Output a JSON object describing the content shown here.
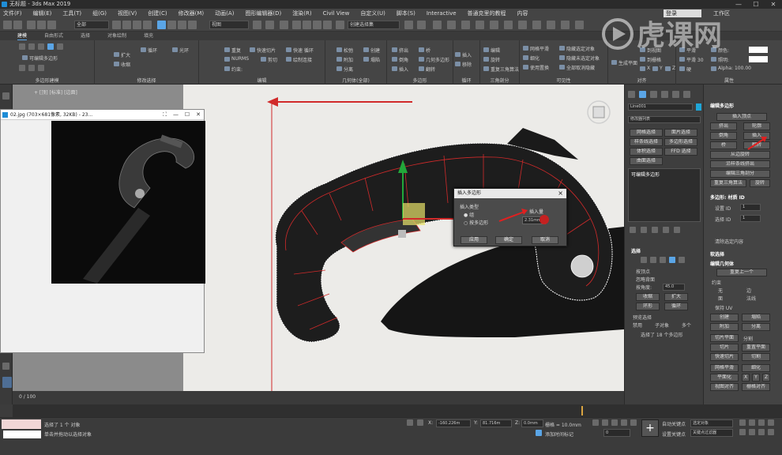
{
  "window": {
    "title": "无标题 - 3ds Max 2019",
    "minimize": "—",
    "maximize": "☐",
    "close": "✕"
  },
  "menu": {
    "items": [
      "文件(F)",
      "编辑(E)",
      "工具(T)",
      "组(G)",
      "视图(V)",
      "创建(C)",
      "修改器(M)",
      "动画(A)",
      "图形编辑器(D)",
      "渲染(R)",
      "Civil View",
      "自定义(U)",
      "脚本(S)",
      "Interactive",
      "普通克里的教程",
      "内容"
    ],
    "signin": "登录",
    "workspace": "工作区"
  },
  "toolbar": {
    "filter": "全部",
    "view": "视图",
    "selection_set": "创建选择集"
  },
  "ribbon": {
    "tabs": [
      "建模",
      "自由形式",
      "选择",
      "对象绘制",
      "填充"
    ],
    "active_tab": "建模",
    "mode_label": "可编辑多边形",
    "groups": [
      {
        "label": "多边形建模",
        "items": []
      },
      {
        "label": "修改选择",
        "items": [
          "扩大",
          "收缩",
          "循环",
          "光环"
        ]
      },
      {
        "label": "编辑",
        "items": [
          "重复",
          "快速切片",
          "快速 循环",
          "NURMS",
          "剪切",
          "绘制连接",
          "约束:"
        ]
      },
      {
        "label": "几何体(全部)",
        "items": [
          "松弛",
          "创建",
          "附加",
          "塌陷",
          "分离"
        ]
      },
      {
        "label": "多边形",
        "items": [
          "挤出",
          "倒角",
          "插入",
          "翻转",
          "桥",
          "几何多边形"
        ]
      },
      {
        "label": "循环",
        "items": [
          "插入",
          "移除"
        ]
      },
      {
        "label": "三角剖分",
        "items": [
          "编辑",
          "旋转",
          "重复三角算法"
        ]
      },
      {
        "label": "可见性",
        "items": [
          "隐藏选定对象",
          "隐藏未选定对象",
          "全部取消隐藏",
          "网格平滑",
          "细化",
          "使用置换"
        ]
      },
      {
        "label": "对齐",
        "items": [
          "生成平面",
          "到视图",
          "到栅格",
          "X",
          "Y",
          "Z"
        ]
      },
      {
        "label": "属性",
        "items": [
          "平滑",
          "平滑 30",
          "硬",
          "颜色:",
          "照明:",
          "Alpha: 100.00"
        ]
      }
    ]
  },
  "viewport": {
    "label": "+ [顶] [标准] [边面]"
  },
  "image_window": {
    "title": "02.jpg (703×681像素, 32KB) - 23..."
  },
  "dialog": {
    "title": "插入多边形",
    "insert_type_label": "插入类型",
    "option_group": "组",
    "option_by_poly": "按多边形",
    "amount_label": "插入量",
    "amount_value": "2.31mm",
    "apply": "应用",
    "ok": "确定",
    "cancel": "取消"
  },
  "command_panel": {
    "object_name": "Line001",
    "modifier_list": "修改器列表",
    "modifier_buttons": [
      "网格选择",
      "面片选择",
      "样条线选择",
      "多边形选择",
      "体积选择",
      "FFD 选择",
      "曲面选择"
    ],
    "stack_item": "可编辑多边形",
    "selection_header": "选择",
    "sel_options": [
      "按顶点",
      "忽略背面",
      "按角度:",
      "45.0",
      "收缩",
      "扩大",
      "环形",
      "循环"
    ],
    "preview_label": "预览选择",
    "preview_options": [
      "禁用",
      "子对象",
      "多个"
    ],
    "selected_text": "选择了 18 个多边形"
  },
  "edit_panel": {
    "edit_poly_header": "编辑多边形",
    "insert_vertex": "插入顶点",
    "buttons": [
      "挤出",
      "轮廓",
      "倒角",
      "插入",
      "桥",
      "翻转",
      "从边旋转",
      "沿样条线挤出",
      "编辑三角剖分",
      "重复三角算法",
      "旋转"
    ],
    "material_header": "多边形: 材质 ID",
    "set_id_label": "设置 ID",
    "set_id_value": "1",
    "select_id_label": "选择 ID",
    "select_id_value": "1",
    "clear_selection": "清除选定内容",
    "soft_select": "软选择",
    "edit_geometry": "编辑几何体",
    "repeat_last": "重复上一个",
    "constraint_label": "约束",
    "constraint_opts": [
      "无",
      "边",
      "面",
      "法线"
    ],
    "keep_uv": "保持 UV",
    "geo_buttons": [
      "创建",
      "塌陷",
      "附加",
      "分离",
      "切片平面",
      "分割",
      "切片",
      "重置平面",
      "快速切片",
      "切割"
    ],
    "mesh_smooth": "网格平滑",
    "tessellate": "细化",
    "planarize": "平面化",
    "xyz": [
      "X",
      "Y",
      "Z"
    ],
    "view_align": "视图对齐",
    "grid_align": "栅格对齐"
  },
  "status": {
    "selected": "选择了 1 个 对象",
    "hint": "单击并拖动以选择对象",
    "x_value": "-160.226m",
    "y_value": "81.716m",
    "z_value": "0.0mm",
    "grid": "栅格 = 10.0mm",
    "add_time_tag": "添加时间标记",
    "autokey": "自动关键点",
    "selected_obj": "选定对象",
    "set_key": "设置关键点",
    "key_filters": "关键点过滤器",
    "frame": "0",
    "timeline_start": "0 / 100"
  },
  "watermark": {
    "text": "虎课网"
  },
  "colors": {
    "accent": "#5aa5e6",
    "panel": "#444444",
    "poly_edge": "#d12a2a",
    "gizmo_green": "#22a83a",
    "gizmo_yellow": "#e8e36a"
  }
}
